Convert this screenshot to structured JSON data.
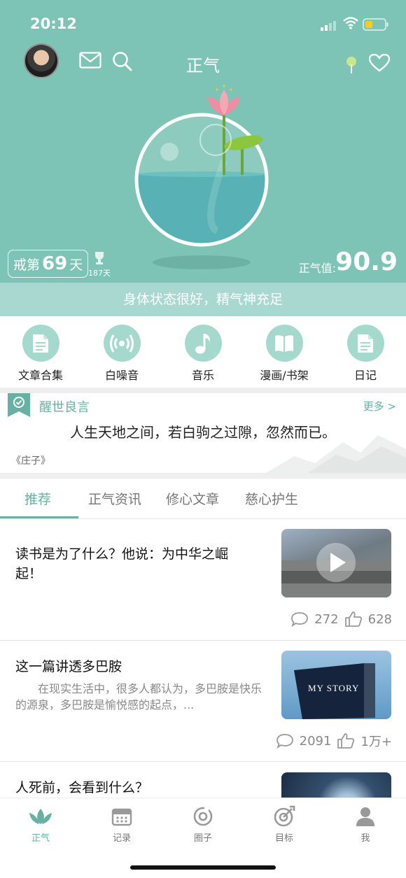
{
  "status": {
    "time": "20:12"
  },
  "header": {
    "title": "正气"
  },
  "stats": {
    "quit_prefix": "戒第",
    "quit_days": "69",
    "quit_suffix": "天",
    "record": "187天",
    "value_label": "正气值:",
    "value": "90.9",
    "state_text": "身体状态很好，精气神充足"
  },
  "quick": [
    {
      "label": "文章合集",
      "icon": "document-icon"
    },
    {
      "label": "白噪音",
      "icon": "broadcast-icon"
    },
    {
      "label": "音乐",
      "icon": "music-note-icon"
    },
    {
      "label": "漫画/书架",
      "icon": "book-icon"
    },
    {
      "label": "日记",
      "icon": "diary-icon"
    }
  ],
  "quote": {
    "title": "醒世良言",
    "more": "更多 >",
    "text": "人生天地之间，若白驹之过隙，忽然而已。",
    "source": "《庄子》"
  },
  "tabs": [
    "推荐",
    "正气资讯",
    "修心文章",
    "慈心护生"
  ],
  "articles": [
    {
      "title": "读书是为了什么？他说：为中华之崛起！",
      "summary": "",
      "comments": "272",
      "likes": "628"
    },
    {
      "title": "这一篇讲透多巴胺",
      "summary": "在现实生活中，很多人都认为，多巴胺是快乐的源泉，多巴胺是愉悦感的起点，...",
      "comments": "2091",
      "likes": "1万+",
      "thumb_text": "MY STORY"
    },
    {
      "title": "人死前，会看到什么？",
      "summary": ""
    }
  ],
  "bottom_nav": [
    {
      "label": "正气",
      "icon": "lotus-icon"
    },
    {
      "label": "记录",
      "icon": "calendar-icon"
    },
    {
      "label": "圈子",
      "icon": "circle-icon"
    },
    {
      "label": "目标",
      "icon": "target-icon"
    },
    {
      "label": "我",
      "icon": "person-icon"
    }
  ],
  "colors": {
    "primary": "#7dc4b6",
    "accent": "#67b1a4",
    "strip": "#a8d8cf"
  }
}
